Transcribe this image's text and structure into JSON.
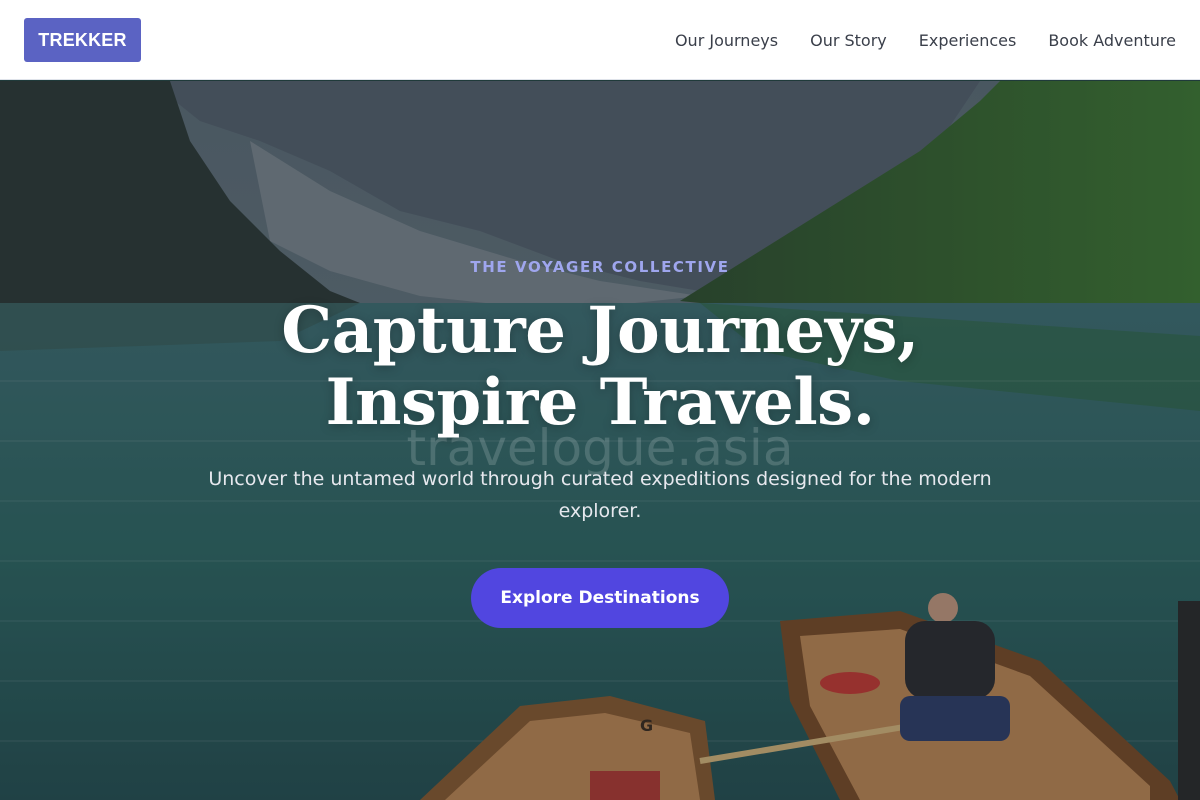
{
  "header": {
    "logo": "TREKKER",
    "nav": [
      {
        "label": "Our Journeys"
      },
      {
        "label": "Our Story"
      },
      {
        "label": "Experiences"
      },
      {
        "label": "Book Adventure"
      }
    ]
  },
  "hero": {
    "eyebrow": "THE VOYAGER COLLECTIVE",
    "headline_line1": "Capture Journeys,",
    "headline_line2": "Inspire Travels.",
    "watermark": "travelogue.asia",
    "subtext": "Uncover the untamed world through curated expeditions designed for the modern explorer.",
    "cta_label": "Explore Destinations",
    "boat_letter": "G"
  },
  "colors": {
    "brand": "#5b63c3",
    "cta": "#5146e0",
    "eyebrow": "#9fa6ee",
    "lake": "#2f6a5f",
    "forest": "#2f5a24"
  }
}
